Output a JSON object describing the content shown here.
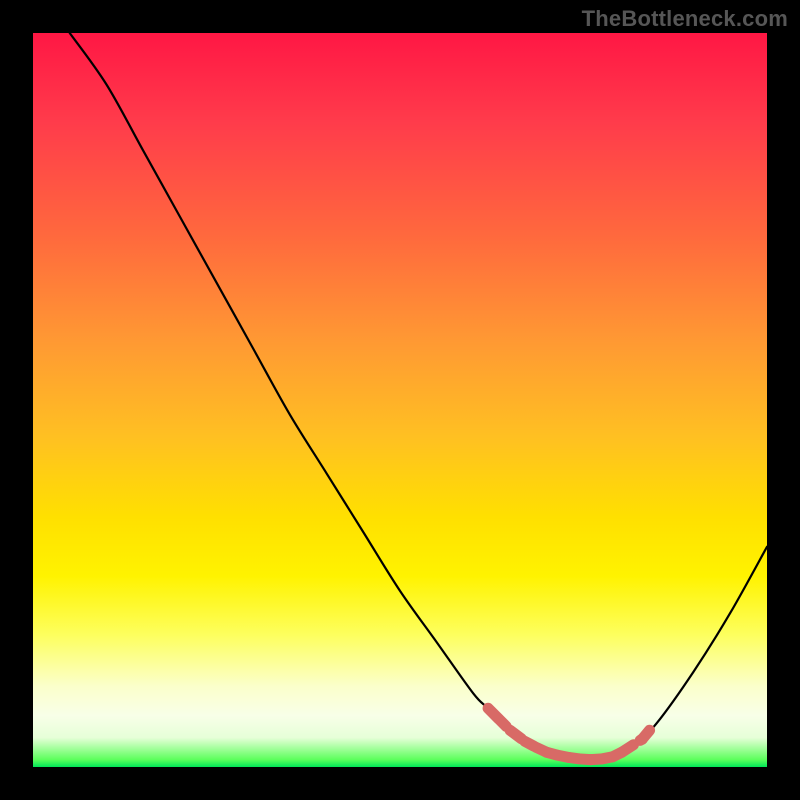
{
  "watermark": "TheBottleneck.com",
  "colors": {
    "frame": "#000000",
    "curve_stroke": "#000000",
    "marker_fill": "#d86a66",
    "gradient_top": "#ff1744",
    "gradient_bottom": "#00e658"
  },
  "chart_data": {
    "type": "line",
    "title": "",
    "xlabel": "",
    "ylabel": "",
    "xlim": [
      0,
      100
    ],
    "ylim": [
      0,
      100
    ],
    "grid": false,
    "series": [
      {
        "name": "bottleneck-curve",
        "x": [
          5,
          10,
          15,
          20,
          25,
          30,
          35,
          40,
          45,
          50,
          55,
          60,
          62,
          65,
          68,
          70,
          72,
          74,
          76,
          78,
          80,
          82,
          85,
          90,
          95,
          100
        ],
        "y": [
          100,
          93,
          84,
          75,
          66,
          57,
          48,
          40,
          32,
          24,
          17,
          10,
          8,
          5,
          3,
          2,
          1.5,
          1.2,
          1.0,
          1.2,
          1.8,
          3,
          6,
          13,
          21,
          30
        ]
      }
    ],
    "markers": {
      "name": "optimal-range",
      "points": [
        {
          "x": 62,
          "y": 8
        },
        {
          "x": 63.5,
          "y": 6.5
        },
        {
          "x": 65,
          "y": 5
        },
        {
          "x": 67,
          "y": 3.5
        },
        {
          "x": 68.5,
          "y": 2.7
        },
        {
          "x": 70,
          "y": 2
        },
        {
          "x": 71.5,
          "y": 1.6
        },
        {
          "x": 73,
          "y": 1.3
        },
        {
          "x": 74.5,
          "y": 1.1
        },
        {
          "x": 76,
          "y": 1.0
        },
        {
          "x": 77.5,
          "y": 1.1
        },
        {
          "x": 79,
          "y": 1.4
        },
        {
          "x": 80.2,
          "y": 2.0
        },
        {
          "x": 83,
          "y": 3.8
        },
        {
          "x": 84,
          "y": 5
        }
      ]
    }
  }
}
